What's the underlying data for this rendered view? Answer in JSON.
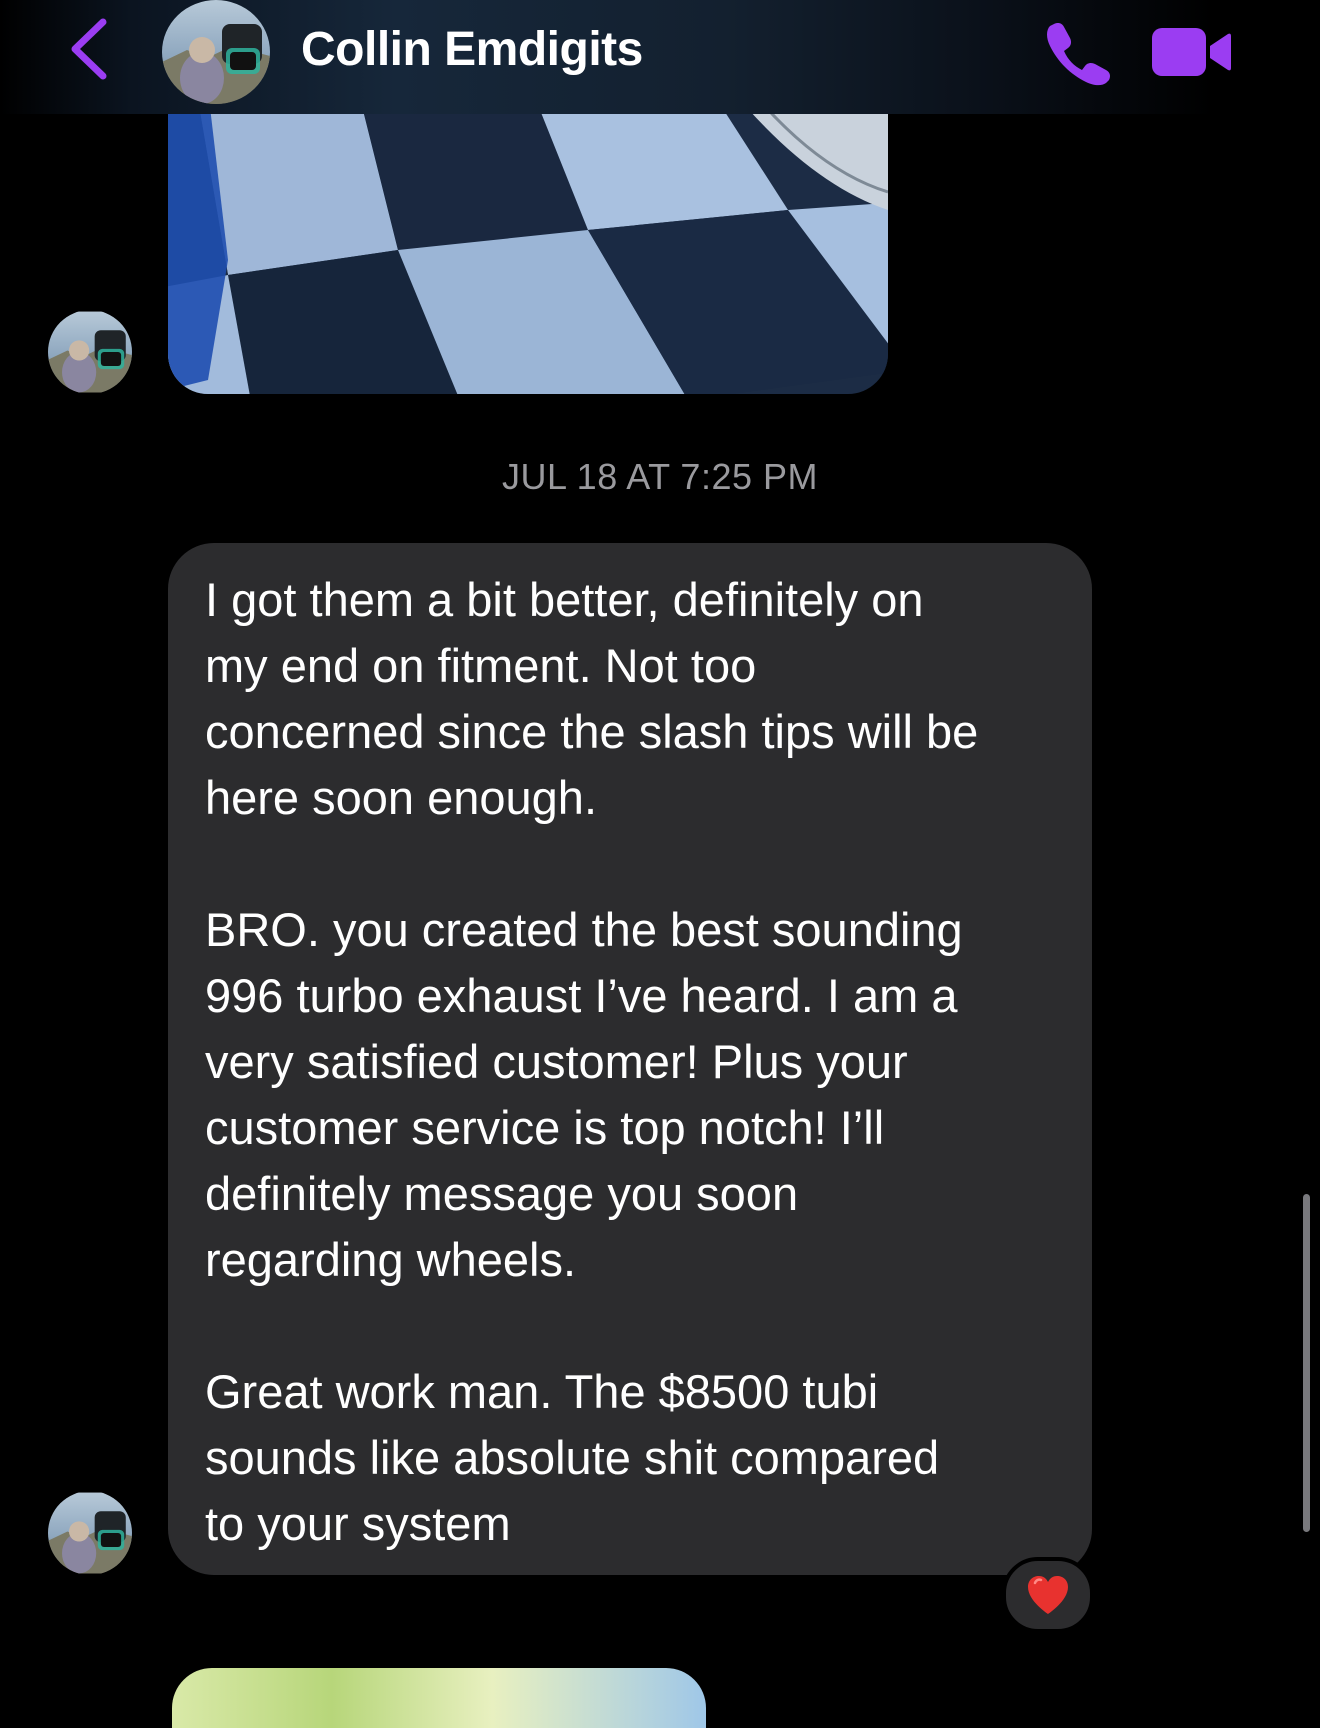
{
  "header": {
    "contact_name": "Collin Emdigits",
    "back_icon": "chevron-left-icon",
    "call_icon": "phone-icon",
    "video_icon": "video-camera-icon",
    "accent_color": "#9b3df2"
  },
  "thread": {
    "timestamp": "JUL 18 AT 7:25 PM",
    "message": {
      "paragraphs": [
        "I got them a bit better, definitely on\nmy end on fitment. Not too\nconcerned since the slash tips will be\nhere soon enough.",
        "BRO. you created the best sounding\n996 turbo exhaust I’ve heard. I am a\nvery satisfied customer! Plus your\ncustomer service is top notch! I’ll\ndefinitely message you soon\nregarding wheels.",
        "Great work man. The $8500 tubi\nsounds like absolute shit compared\nto your system"
      ],
      "reaction": "❤️"
    }
  },
  "colors": {
    "background": "#000000",
    "incoming_bubble": "#2c2c2e",
    "timestamp_text": "#9a9a9e"
  }
}
